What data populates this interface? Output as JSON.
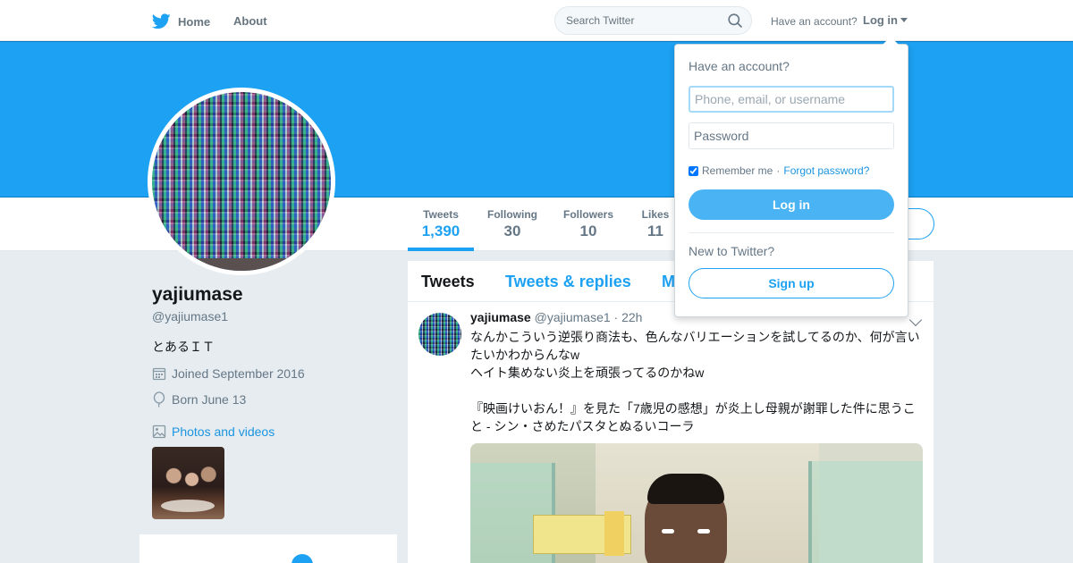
{
  "nav": {
    "home_label": "Home",
    "about_label": "About",
    "search_placeholder": "Search Twitter",
    "have_account": "Have an account?",
    "login_label": "Log in"
  },
  "profile": {
    "name": "yajiumase",
    "handle": "@yajiumase1",
    "bio": "とあるＩＴ",
    "joined": "Joined September 2016",
    "born": "Born June 13",
    "photos_link": "Photos and videos"
  },
  "stats": [
    {
      "label": "Tweets",
      "value": "1,390"
    },
    {
      "label": "Following",
      "value": "30"
    },
    {
      "label": "Followers",
      "value": "10"
    },
    {
      "label": "Likes",
      "value": "11"
    }
  ],
  "timeline": {
    "tabs": [
      "Tweets",
      "Tweets & replies",
      "M"
    ]
  },
  "tweet": {
    "name": "yajiumase",
    "handle": "@yajiumase1",
    "dot": "·",
    "time": "22h",
    "line1": "なんかこういう逆張り商法も、色んなバリエーションを試してるのか、何が言いたいかわからんなw",
    "line2": "ヘイト集めない炎上を頑張ってるのかねw",
    "line3": "『映画けいおん！』を見た「7歳児の感想」が炎上し母親が謝罪した件に思うこと - シン・さめたパスタとぬるいコーラ"
  },
  "login_dropdown": {
    "title": "Have an account?",
    "username_placeholder": "Phone, email, or username",
    "password_placeholder": "Password",
    "remember": "Remember me",
    "separator": "·",
    "forgot": "Forgot password?",
    "login_button": "Log in",
    "new_to_twitter": "New to Twitter?",
    "signup_button": "Sign up"
  },
  "colors": {
    "brand_blue": "#1da1f2",
    "link_blue": "#1b95e0",
    "page_bg": "#e6ecf0"
  },
  "icons": [
    "twitter-bird-icon",
    "search-icon",
    "calendar-icon",
    "balloon-icon",
    "photo-icon",
    "chevron-down-icon"
  ]
}
